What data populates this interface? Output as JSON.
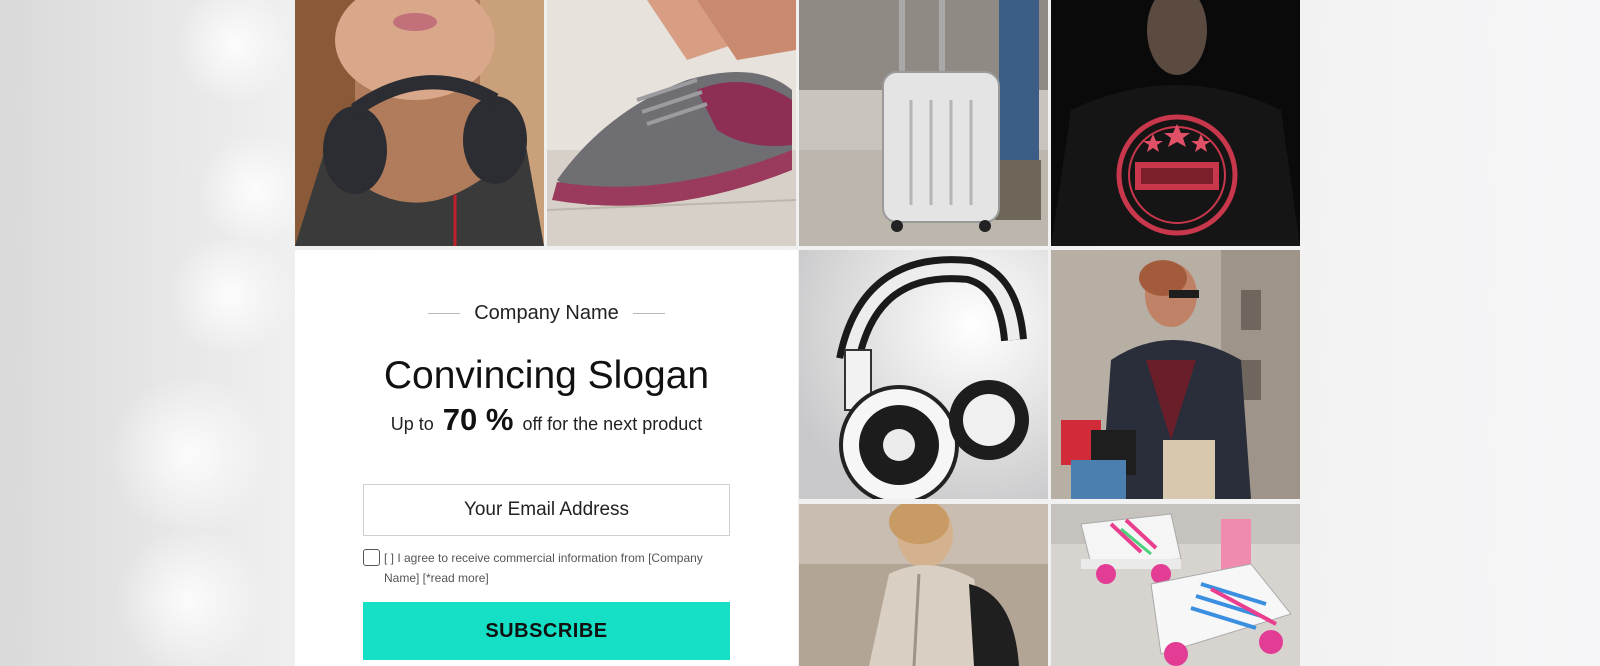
{
  "popup": {
    "company_name": "Company Name",
    "slogan": "Convincing Slogan",
    "offer_prefix": "Up to",
    "offer_value": "70 %",
    "offer_suffix": "off for the next product",
    "email_placeholder": "Your Email Address",
    "consent_text": "[ ] I agree to receive commercial information from [Company Name] [*read more]",
    "subscribe_label": "SUBSCRIBE"
  },
  "colors": {
    "accent": "#15dfc4",
    "card_background": "#ffffff",
    "page_background": "#efefef"
  },
  "tiles": [
    {
      "name": "woman-headphones-photo"
    },
    {
      "name": "tying-sneaker-photo"
    },
    {
      "name": "silver-suitcase-photo"
    },
    {
      "name": "legendary-tshirt-photo"
    },
    {
      "name": "white-headphones-photo"
    },
    {
      "name": "woman-shopping-bags-photo"
    },
    {
      "name": "woman-backpack-photo"
    },
    {
      "name": "roller-skates-photo"
    }
  ]
}
